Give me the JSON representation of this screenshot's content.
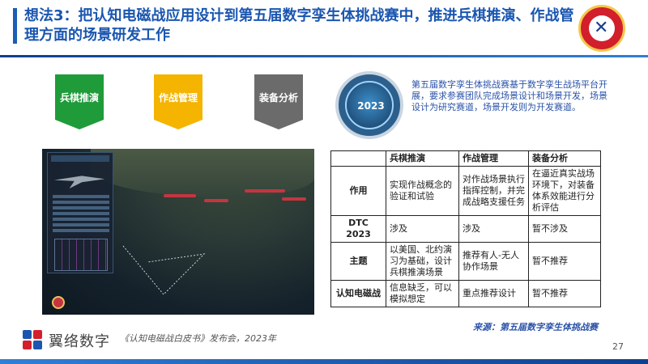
{
  "header": {
    "title": "想法3：把认知电磁战应用设计到第五届数字孪生体挑战赛中，推进兵棋推演、作战管理方面的场景研发工作"
  },
  "tags": [
    {
      "label": "兵棋推演",
      "color": "#1f9b3a"
    },
    {
      "label": "作战管理",
      "color": "#f4b400"
    },
    {
      "label": "装备分析",
      "color": "#6b6b6b"
    }
  ],
  "emblem": {
    "year": "2023"
  },
  "description": "第五届数字孪生体挑战赛基于数字孪生战场平台开展，要求参赛团队完成场景设计和场景开发，场景设计为研究赛道，场景开发则为开发赛道。",
  "table": {
    "headers": [
      "",
      "兵棋推演",
      "作战管理",
      "装备分析"
    ],
    "rows": [
      [
        "作用",
        "实现作战概念的验证和试验",
        "对作战场景执行指挥控制，并完成战略支援任务",
        "在逼近真实战场环境下，对装备体系效能进行分析评估"
      ],
      [
        "DTC 2023",
        "涉及",
        "涉及",
        "暂不涉及"
      ],
      [
        "主题",
        "以美国、北约演习为基础，设计兵棋推演场景",
        "推荐有人-无人协作场景",
        "暂不推荐"
      ],
      [
        "认知电磁战",
        "信息缺乏，可以模拟想定",
        "重点推荐设计",
        "暂不推荐"
      ]
    ]
  },
  "source": "来源：第五届数字孪生体挑战赛",
  "footer": {
    "brand": "翼络数字",
    "note": "《认知电磁战白皮书》发布会，2023年",
    "page": "27"
  },
  "colors": {
    "accent": "#1a56b0",
    "brand_red": "#d21f2b"
  }
}
